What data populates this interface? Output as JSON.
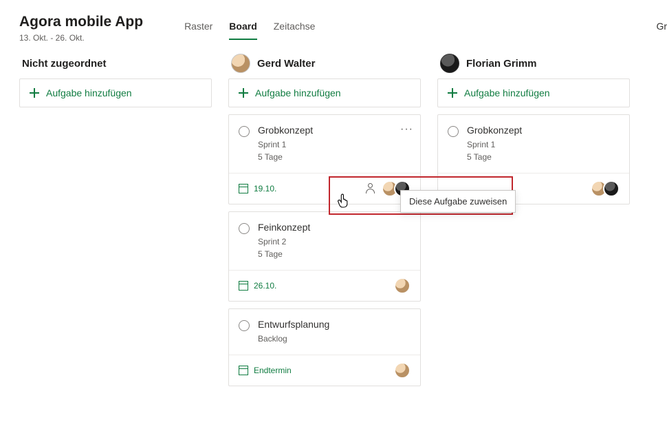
{
  "header": {
    "title": "Agora mobile App",
    "date_range": "13. Okt. - 26. Okt.",
    "right_fragment": "Gr"
  },
  "tabs": [
    {
      "label": "Raster",
      "active": false
    },
    {
      "label": "Board",
      "active": true
    },
    {
      "label": "Zeitachse",
      "active": false
    }
  ],
  "add_task_label": "Aufgabe hinzufügen",
  "tooltip": {
    "assign_task": "Diese Aufgabe zuweisen"
  },
  "columns": [
    {
      "id": "unassigned",
      "title": "Nicht zugeordnet",
      "avatar": null,
      "tasks": []
    },
    {
      "id": "gerd",
      "title": "Gerd Walter",
      "avatar": "gw",
      "tasks": [
        {
          "title": "Grobkonzept",
          "sprint": "Sprint 1",
          "duration": "5 Tage",
          "date": "19.10.",
          "assignees": [
            "gw",
            "fg"
          ],
          "show_menu": true,
          "show_assign_icon": true
        },
        {
          "title": "Feinkonzept",
          "sprint": "Sprint 2",
          "duration": "5 Tage",
          "date": "26.10.",
          "assignees": [
            "gw"
          ],
          "show_menu": false,
          "show_assign_icon": false
        },
        {
          "title": "Entwurfsplanung",
          "sprint": "Backlog",
          "duration": "",
          "date": "Endtermin",
          "assignees": [
            "gw"
          ],
          "show_menu": false,
          "show_assign_icon": false
        }
      ]
    },
    {
      "id": "florian",
      "title": "Florian Grimm",
      "avatar": "fg",
      "tasks": [
        {
          "title": "Grobkonzept",
          "sprint": "Sprint 1",
          "duration": "5 Tage",
          "date": "",
          "assignees": [
            "gw",
            "fg"
          ],
          "show_menu": false,
          "show_assign_icon": false
        }
      ]
    }
  ]
}
